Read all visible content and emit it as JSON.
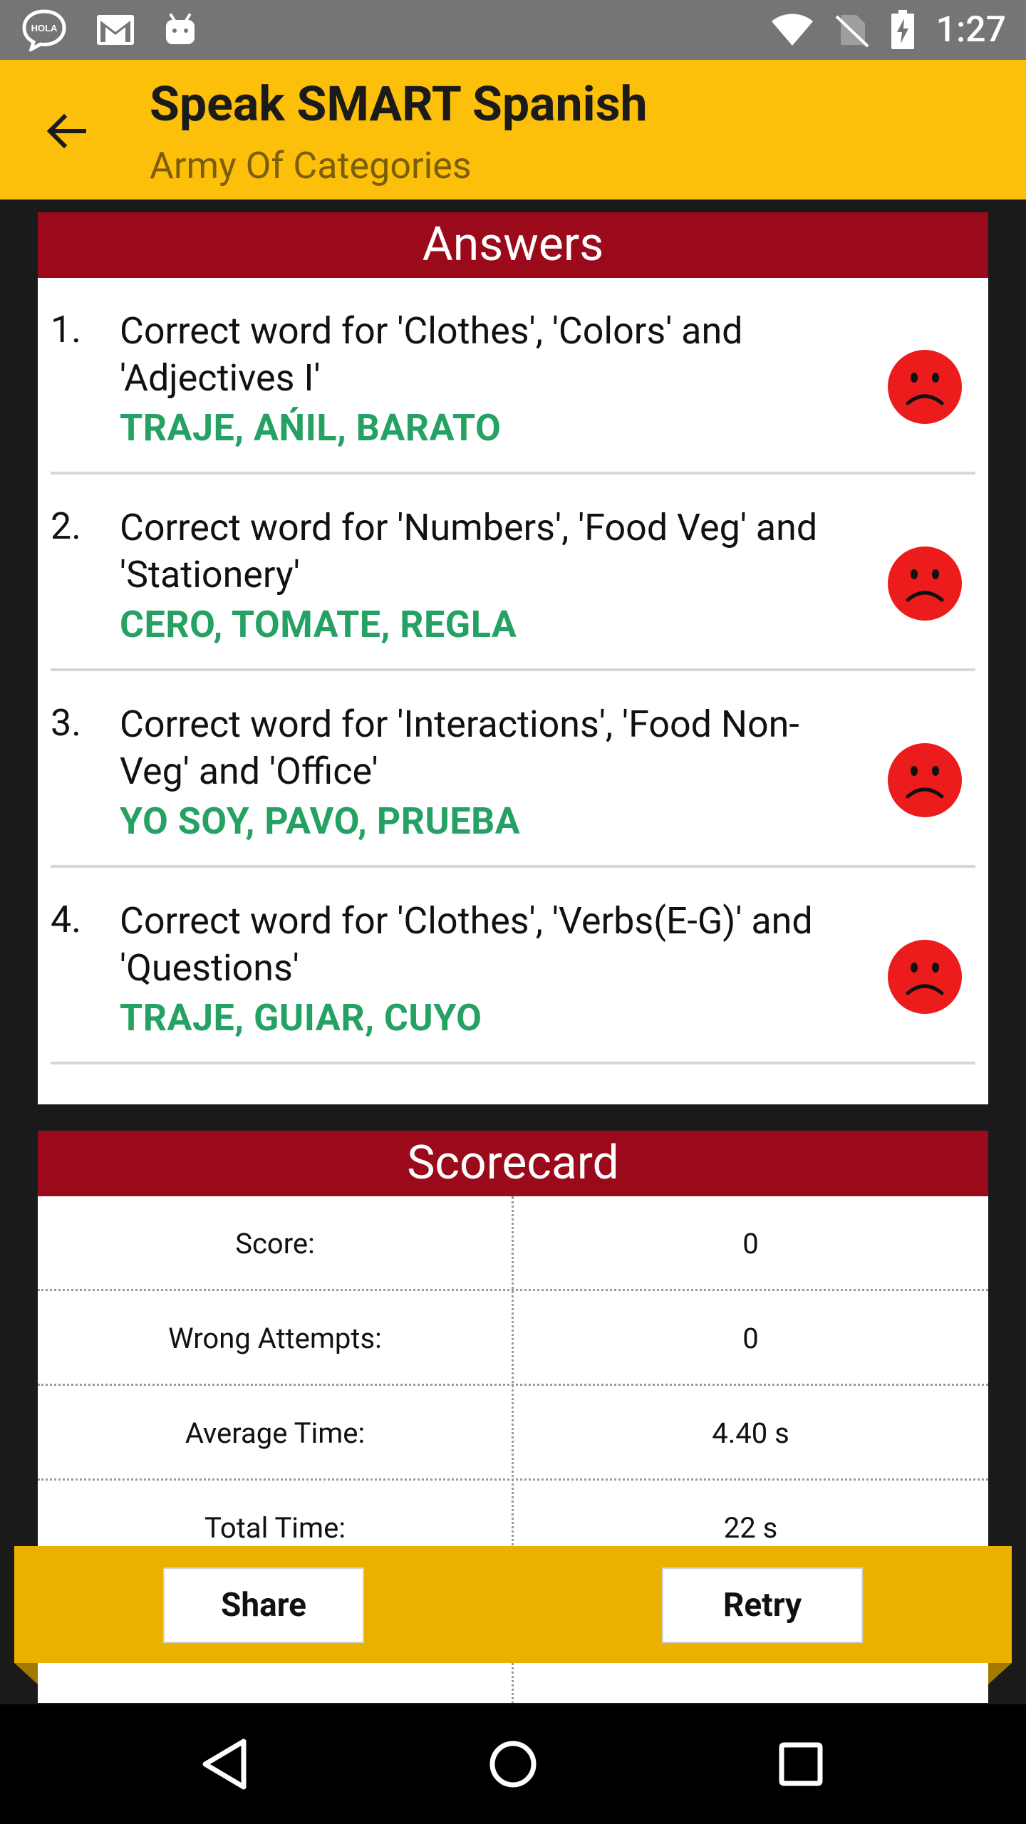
{
  "status_bar": {
    "time": "1:27",
    "left_icons": [
      "hola-chat-icon",
      "gmail-icon",
      "android-debug-icon"
    ],
    "right_icons": [
      "wifi-icon",
      "no-sim-icon",
      "battery-charging-icon"
    ]
  },
  "app_bar": {
    "title": "Speak SMART Spanish",
    "subtitle": "Army Of Categories",
    "background": "#fcc00b"
  },
  "answers": {
    "header": "Answers",
    "header_color": "#9b0a1a",
    "answer_color": "#24a163",
    "items": [
      {
        "number": "1.",
        "question": "Correct word for 'Clothes', 'Colors' and 'Adjectives I'",
        "answer": "TRAJE, AŃIL, BARATO",
        "result_icon": "sad-face-icon"
      },
      {
        "number": "2.",
        "question": "Correct word for 'Numbers', 'Food Veg' and 'Stationery'",
        "answer": "CERO, TOMATE, REGLA",
        "result_icon": "sad-face-icon"
      },
      {
        "number": "3.",
        "question": "Correct word for 'Interactions', 'Food Non-Veg' and 'Office'",
        "answer": "YO SOY, PAVO, PRUEBA",
        "result_icon": "sad-face-icon"
      },
      {
        "number": "4.",
        "question": "Correct word for 'Clothes', 'Verbs(E-G)' and 'Questions'",
        "answer": "TRAJE, GUIAR, CUYO",
        "result_icon": "sad-face-icon"
      }
    ]
  },
  "scorecard": {
    "header": "Scorecard",
    "rows": [
      {
        "label": "Score:",
        "value": "0"
      },
      {
        "label": "Wrong Attempts:",
        "value": "0"
      },
      {
        "label": "Average Time:",
        "value": "4.40 s"
      },
      {
        "label": "Total Time:",
        "value": "22 s"
      }
    ]
  },
  "actions": {
    "share_label": "Share",
    "retry_label": "Retry",
    "ribbon_color": "#ebb100"
  },
  "nav_bar": {
    "icons": [
      "back-triangle-icon",
      "home-circle-icon",
      "recents-square-icon"
    ]
  }
}
